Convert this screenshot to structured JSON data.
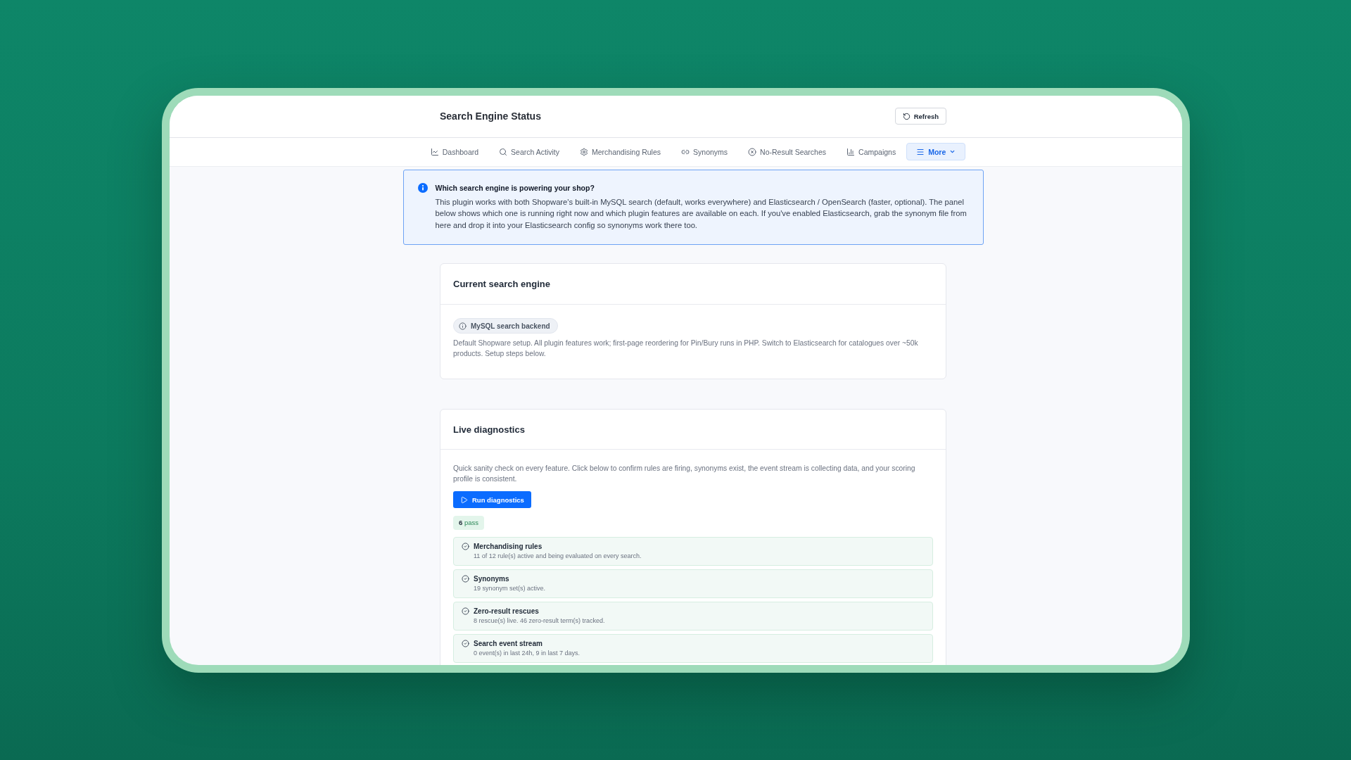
{
  "header": {
    "title": "Search Engine Status",
    "refresh_button": "Refresh"
  },
  "nav": [
    {
      "label": "Dashboard",
      "kind": "tab",
      "selected": false
    },
    {
      "label": "Search Activity",
      "kind": "tab",
      "selected": false
    },
    {
      "label": "Merchandising Rules",
      "kind": "tab",
      "selected": false
    },
    {
      "label": "Synonyms",
      "kind": "tab",
      "selected": false
    },
    {
      "label": "No-Result Searches",
      "kind": "tab",
      "selected": false
    },
    {
      "label": "Campaigns",
      "kind": "tab",
      "selected": false
    },
    {
      "label": "More",
      "kind": "menu",
      "selected": true
    }
  ],
  "banner": {
    "title": "Which search engine is powering your shop?",
    "text": "This plugin works with both Shopware's built-in MySQL search (default, works everywhere) and Elasticsearch / OpenSearch (faster, optional). The panel below shows which one is running right now and which plugin features are available on each. If you've enabled Elasticsearch, grab the synonym file from here and drop it into your Elasticsearch config so synonyms work there too."
  },
  "engine_card": {
    "title": "Current search engine",
    "badge": "MySQL search backend",
    "description": "Default Shopware setup. All plugin features work; first-page reordering for Pin/Bury runs in PHP. Switch to Elasticsearch for catalogues over ~50k products. Setup steps below."
  },
  "diagnostics_card": {
    "title": "Live diagnostics",
    "description": "Quick sanity check on every feature. Click below to confirm rules are firing, synonyms exist, the event stream is collecting data, and your scoring profile is consistent.",
    "run_button": "Run diagnostics",
    "summary": "**6** pass",
    "checks": [
      {
        "title": "Merchandising rules",
        "detail": "11 of 12 rule(s) active and being evaluated on every search.",
        "passed": true
      },
      {
        "title": "Synonyms",
        "detail": "19 synonym set(s) active.",
        "passed": true
      },
      {
        "title": "Zero-result rescues",
        "detail": "8 rescue(s) live. 46 zero-result term(s) tracked.",
        "passed": true
      },
      {
        "title": "Search event stream",
        "detail": "0 event(s) in last 24h, 9 in last 7 days.",
        "passed": true
      }
    ]
  }
}
